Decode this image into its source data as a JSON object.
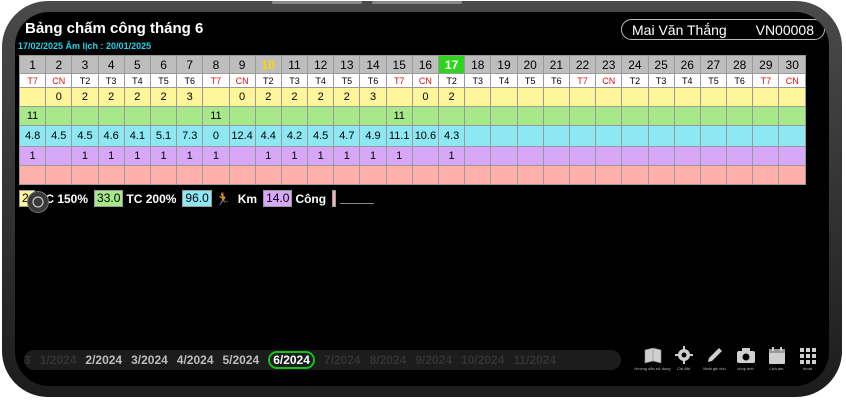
{
  "header": {
    "title": "Bảng chấm công tháng 6",
    "dates": "17/02/2025  Âm lịch : 20/01/2025",
    "user_name": "Mai Văn Thắng",
    "user_id": "VN00008"
  },
  "grid": {
    "days": [
      "1",
      "2",
      "3",
      "4",
      "5",
      "6",
      "7",
      "8",
      "9",
      "10",
      "11",
      "12",
      "13",
      "14",
      "15",
      "16",
      "17",
      "18",
      "19",
      "20",
      "21",
      "22",
      "23",
      "24",
      "25",
      "26",
      "27",
      "28",
      "29",
      "30"
    ],
    "weekdays": [
      "T7",
      "CN",
      "T2",
      "T3",
      "T4",
      "T5",
      "T6",
      "T7",
      "CN",
      "T2",
      "T3",
      "T4",
      "T5",
      "T6",
      "T7",
      "CN",
      "T2",
      "T3",
      "T4",
      "T5",
      "T6",
      "T7",
      "CN",
      "T2",
      "T3",
      "T4",
      "T5",
      "T6",
      "T7",
      "CN"
    ],
    "row_work": [
      "",
      "0",
      "2",
      "2",
      "2",
      "2",
      "3",
      "",
      "0",
      "2",
      "2",
      "2",
      "2",
      "3",
      "",
      "0",
      "2",
      "",
      "",
      "",
      "",
      "",
      "",
      "",
      "",
      "",
      "",
      "",
      "",
      ""
    ],
    "row_ot": [
      "11",
      "",
      "",
      "",
      "",
      "",
      "",
      "11",
      "",
      "",
      "",
      "",
      "",
      "",
      "11",
      "",
      "",
      "",
      "",
      "",
      "",
      "",
      "",
      "",
      "",
      "",
      "",
      "",
      "",
      ""
    ],
    "row_km": [
      "4.8",
      "4.5",
      "4.5",
      "4.6",
      "4.1",
      "5.1",
      "7.3",
      "0",
      "12.4",
      "4.4",
      "4.2",
      "4.5",
      "4.7",
      "4.9",
      "11.1",
      "10.6",
      "4.3",
      "",
      "",
      "",
      "",
      "",
      "",
      "",
      "",
      "",
      "",
      "",
      "",
      ""
    ],
    "row_cong": [
      "1",
      "",
      "1",
      "1",
      "1",
      "1",
      "1",
      "1",
      "",
      "1",
      "1",
      "1",
      "1",
      "1",
      "1",
      "",
      "1",
      "",
      "",
      "",
      "",
      "",
      "",
      "",
      "",
      "",
      "",
      "",
      "",
      ""
    ],
    "row_extra": [
      "",
      "",
      "",
      "",
      "",
      "",
      "",
      "",
      "",
      "",
      "",
      "",
      "",
      "",
      "",
      "",
      "",
      "",
      "",
      "",
      "",
      "",
      "",
      "",
      "",
      "",
      "",
      "",
      "",
      ""
    ],
    "today_day": "17",
    "highlight_day": "10"
  },
  "legend": {
    "box1_value": "2",
    "label1": "TC 150%",
    "box2_value": "33.0",
    "label2": "TC 200%",
    "box3_value": "96.0",
    "label3": "Km",
    "box4_value": "14.0",
    "label4": "Công"
  },
  "months": {
    "items": [
      "3",
      "1/2024",
      "2/2024",
      "3/2024",
      "4/2024",
      "5/2024",
      "6/2024",
      "7/2024",
      "8/2024",
      "9/2024",
      "10/2024",
      "11/2024"
    ],
    "active": "6/2024"
  },
  "toolbar": {
    "items": [
      {
        "icon": "book-icon",
        "label": "Hướng dẫn sử dụng"
      },
      {
        "icon": "gear-icon",
        "label": "Cài đặt"
      },
      {
        "icon": "pencil-icon",
        "label": "Nhật ghi chú"
      },
      {
        "icon": "camera-icon",
        "label": "chụp ảnh"
      },
      {
        "icon": "calendar-icon",
        "label": "Lịch âm"
      },
      {
        "icon": "grid-icon",
        "label": "thoát"
      }
    ]
  },
  "colors": {
    "today": "#2fd41e",
    "highlight_day": "#ffd700",
    "row_work": "#fff59a",
    "row_ot": "#a6e88a",
    "row_km": "#8de8f3",
    "row_cong": "#d8a8f8",
    "row_extra": "#ffb0ab",
    "weekend": "#e01010",
    "date_text": "#22d4e8",
    "month_active_border": "#12c21a"
  }
}
